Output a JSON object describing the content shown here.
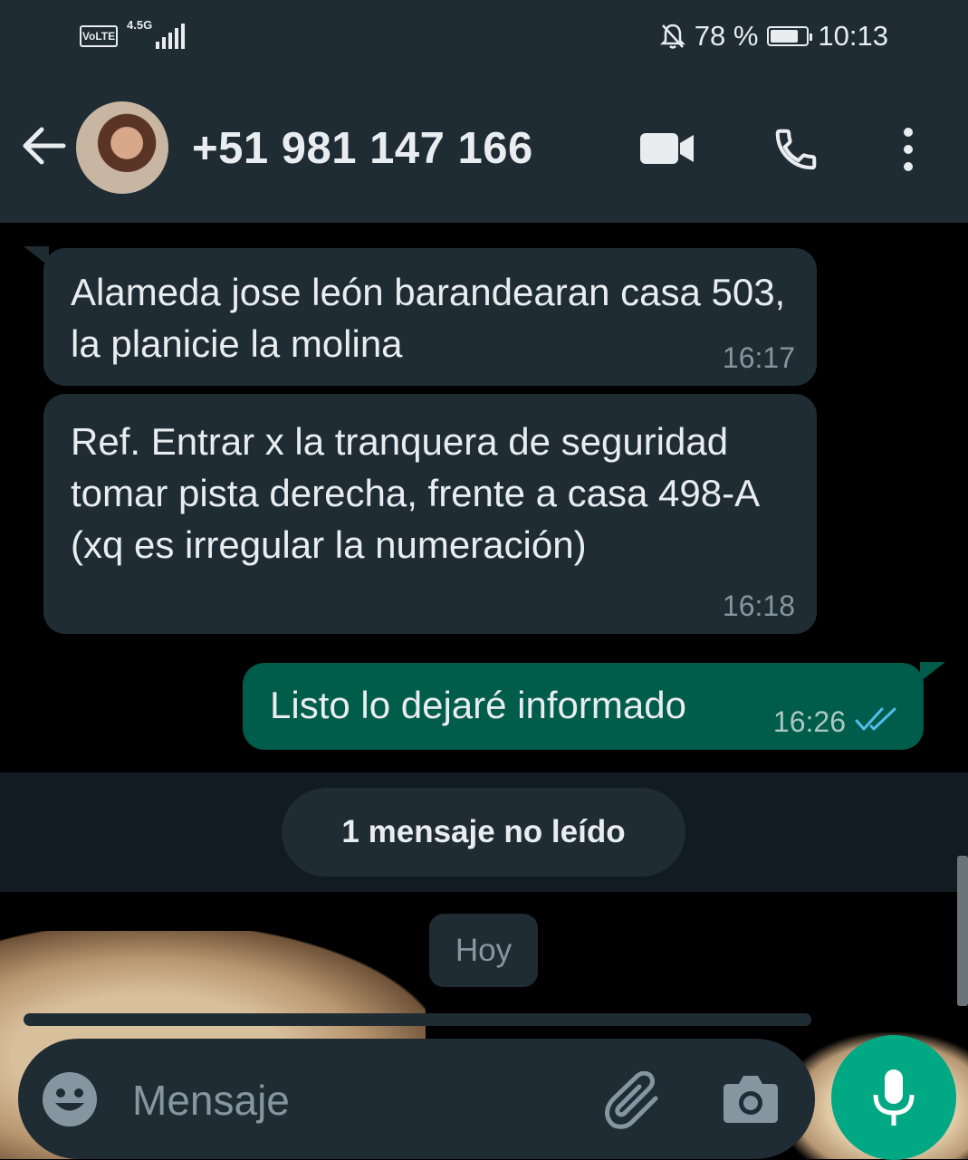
{
  "status_bar": {
    "volte": "VoLTE",
    "network": "4.5G",
    "battery_percent": "78 %",
    "battery_level": 0.78,
    "time": "10:13"
  },
  "header": {
    "contact": "+51 981 147 166",
    "icons": [
      "back-arrow-icon",
      "avatar",
      "video-call-icon",
      "phone-icon",
      "more-vert-icon"
    ]
  },
  "messages": [
    {
      "direction": "in",
      "text": "Alameda jose león barandearan casa 503, la planicie la molina",
      "time": "16:17"
    },
    {
      "direction": "in",
      "text": "Ref. Entrar x la tranquera de seguridad tomar pista derecha, frente a casa 498-A (xq es irregular la numeración)",
      "time": "16:18"
    },
    {
      "direction": "out",
      "text": "Listo lo dejaré informado",
      "time": "16:26",
      "read": true
    }
  ],
  "unread_banner": "1 mensaje no leído",
  "day_label": "Hoy",
  "composer": {
    "placeholder": "Mensaje",
    "icons": [
      "emoji-icon",
      "attach-icon",
      "camera-icon",
      "mic-icon"
    ]
  },
  "colors": {
    "header_bg": "#1f2c34",
    "incoming_bubble": "#1f2c34",
    "outgoing_bubble": "#005c4b",
    "accent": "#00a884",
    "read_ticks": "#53bdeb"
  }
}
